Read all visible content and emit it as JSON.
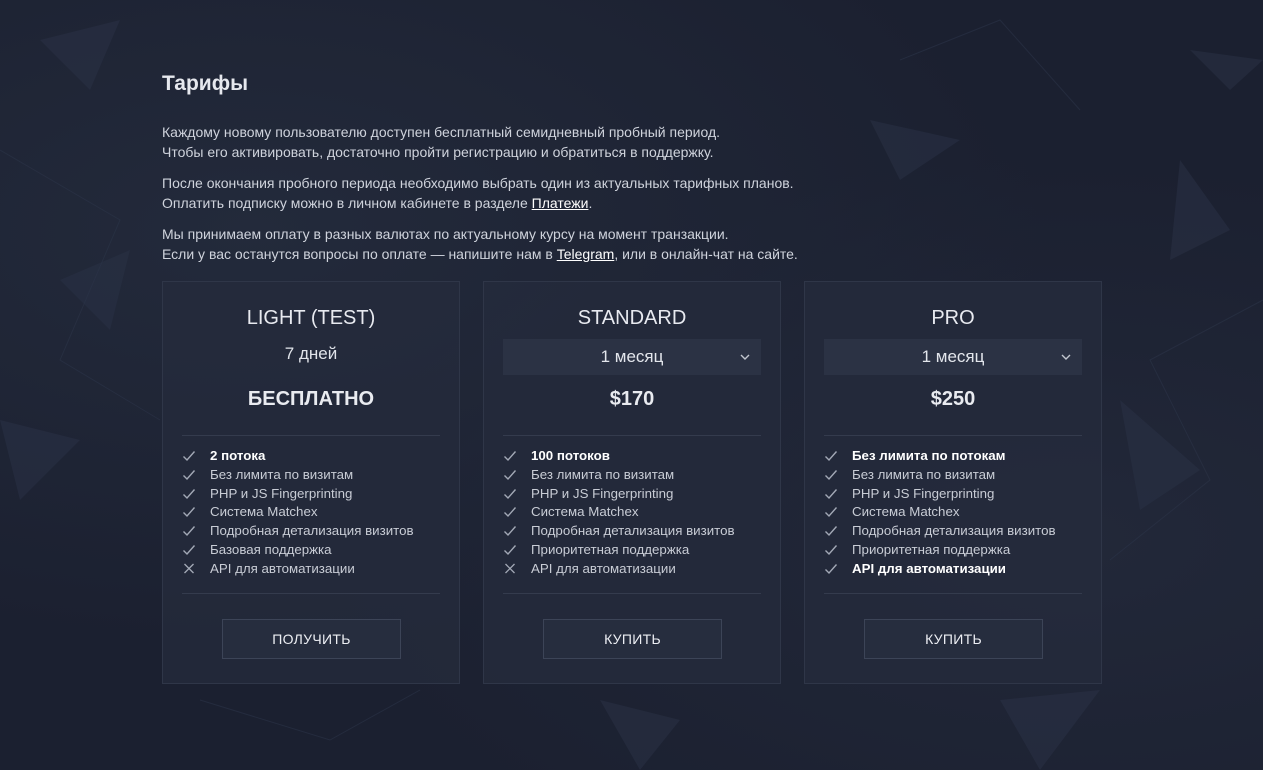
{
  "page": {
    "title": "Тарифы",
    "intro": [
      {
        "line1": "Каждому новому пользователю доступен бесплатный семидневный пробный период.",
        "line2": "Чтобы его активировать, достаточно пройти регистрацию и обратиться в поддержку."
      },
      {
        "line1": "После окончания пробного периода необходимо выбрать один из актуальных тарифных планов.",
        "line2_pre": "Оплатить подписку можно в личном кабинете в разделе ",
        "link": "Платежи",
        "line2_post": "."
      },
      {
        "line1": "Мы принимаем оплату в разных валютах по актуальному курсу на момент транзакции.",
        "line2_pre": "Если у вас останутся вопросы по оплате — напишите нам в ",
        "link": "Telegram",
        "line2_post": ", или в онлайн-чат на сайте."
      }
    ]
  },
  "plans": [
    {
      "name": "LIGHT (TEST)",
      "period": "7 дней",
      "price": "БЕСПЛАТНО",
      "features": [
        {
          "text": "2 потока",
          "included": true,
          "bold": true
        },
        {
          "text": "Без лимита по визитам",
          "included": true,
          "bold": false
        },
        {
          "text": "PHP и JS Fingerprinting",
          "included": true,
          "bold": false
        },
        {
          "text": "Система Matchex",
          "included": true,
          "bold": false
        },
        {
          "text": "Подробная детализация визитов",
          "included": true,
          "bold": false
        },
        {
          "text": "Базовая поддержка",
          "included": true,
          "bold": false
        },
        {
          "text": "API для автоматизации",
          "included": false,
          "bold": false
        }
      ],
      "button": "ПОЛУЧИТЬ"
    },
    {
      "name": "STANDARD",
      "period_select": "1 месяц",
      "price": "$170",
      "features": [
        {
          "text": "100 потоков",
          "included": true,
          "bold": true
        },
        {
          "text": "Без лимита по визитам",
          "included": true,
          "bold": false
        },
        {
          "text": "PHP и JS Fingerprinting",
          "included": true,
          "bold": false
        },
        {
          "text": "Система Matchex",
          "included": true,
          "bold": false
        },
        {
          "text": "Подробная детализация визитов",
          "included": true,
          "bold": false
        },
        {
          "text": "Приоритетная поддержка",
          "included": true,
          "bold": false
        },
        {
          "text": "API для автоматизации",
          "included": false,
          "bold": false
        }
      ],
      "button": "КУПИТЬ"
    },
    {
      "name": "PRO",
      "period_select": "1 месяц",
      "price": "$250",
      "features": [
        {
          "text": "Без лимита по потокам",
          "included": true,
          "bold": true
        },
        {
          "text": "Без лимита по визитам",
          "included": true,
          "bold": false
        },
        {
          "text": "PHP и JS Fingerprinting",
          "included": true,
          "bold": false
        },
        {
          "text": "Система Matchex",
          "included": true,
          "bold": false
        },
        {
          "text": "Подробная детализация визитов",
          "included": true,
          "bold": false
        },
        {
          "text": "Приоритетная поддержка",
          "included": true,
          "bold": false
        },
        {
          "text": "API для автоматизации",
          "included": true,
          "bold": true
        }
      ],
      "button": "КУПИТЬ"
    }
  ],
  "icons": {
    "included": "check-icon",
    "excluded": "cross-icon",
    "dropdown": "chevron-down-icon"
  },
  "colors": {
    "background": "#1b2030",
    "card": "#242b3c",
    "text": "#d6d9e0",
    "accent": "#ffffff"
  }
}
